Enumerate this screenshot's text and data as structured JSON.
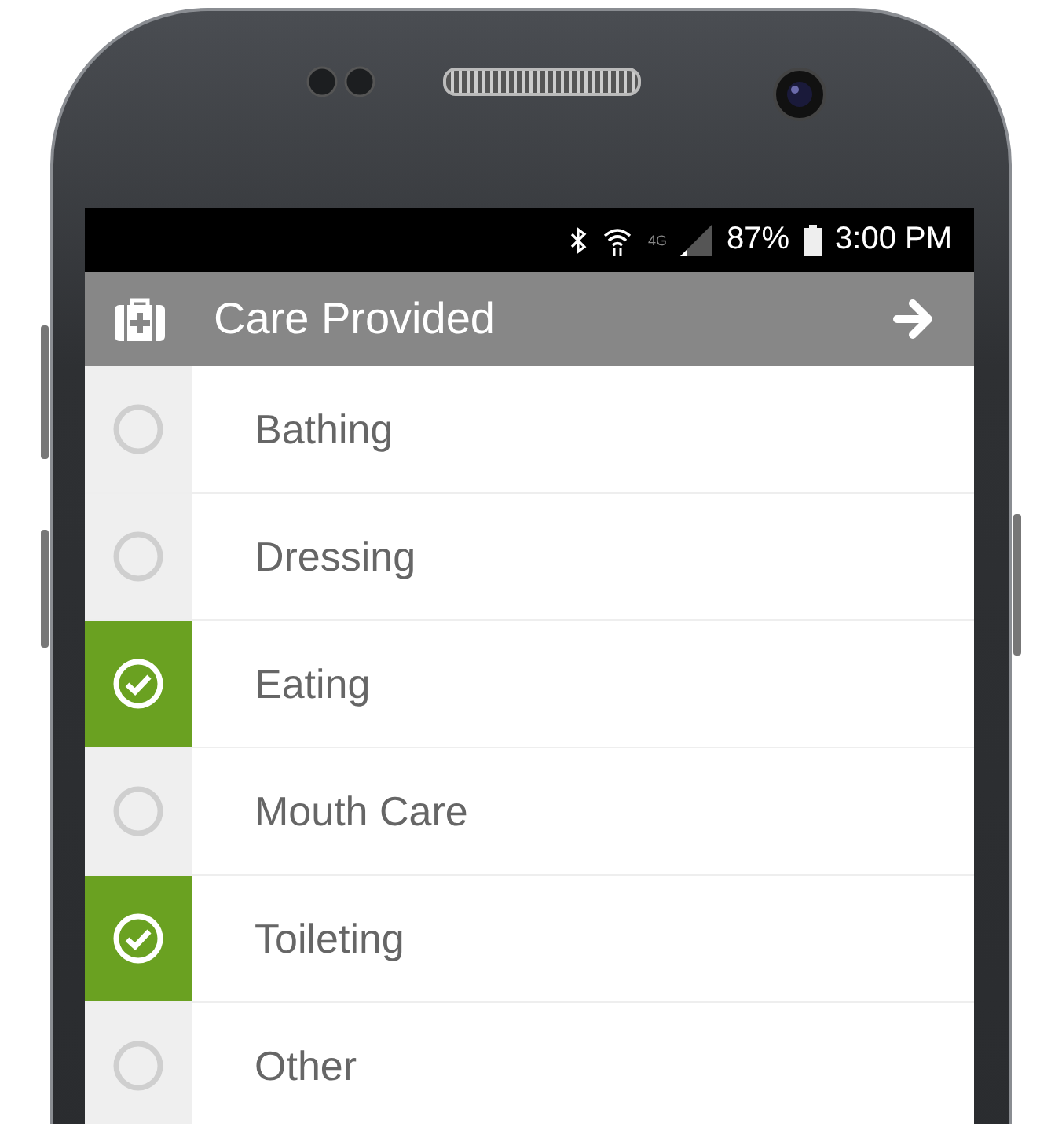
{
  "status_bar": {
    "network": "4G",
    "battery": "87%",
    "time": "3:00 PM"
  },
  "header": {
    "title": "Care Provided"
  },
  "items": [
    {
      "label": "Bathing",
      "checked": false
    },
    {
      "label": "Dressing",
      "checked": false
    },
    {
      "label": "Eating",
      "checked": true
    },
    {
      "label": "Mouth Care",
      "checked": false
    },
    {
      "label": "Toileting",
      "checked": true
    },
    {
      "label": "Other",
      "checked": false
    }
  ]
}
